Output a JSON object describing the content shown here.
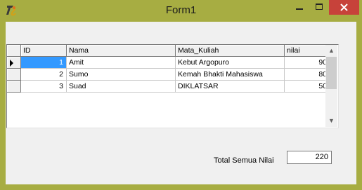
{
  "window": {
    "title": "Form1"
  },
  "titlebar": {
    "minimize_icon": "minimize-icon",
    "maximize_icon": "maximize-icon",
    "close_icon": "close-icon",
    "close_color": "#c7423a"
  },
  "grid": {
    "columns": [
      "ID",
      "Nama",
      "Mata_Kuliah",
      "nilai"
    ],
    "rows": [
      {
        "id": "1",
        "nama": "Amit",
        "mata_kuliah": "Kebut Argopuro",
        "nilai": "90",
        "selected": true
      },
      {
        "id": "2",
        "nama": "Sumo",
        "mata_kuliah": "Kemah Bhakti Mahasiswa",
        "nilai": "80",
        "selected": false
      },
      {
        "id": "3",
        "nama": "Suad",
        "mata_kuliah": "DIKLATSAR",
        "nilai": "50",
        "selected": false
      }
    ],
    "selection_color": "#3399ff"
  },
  "total": {
    "label": "Total Semua Nilai",
    "value": "220"
  }
}
